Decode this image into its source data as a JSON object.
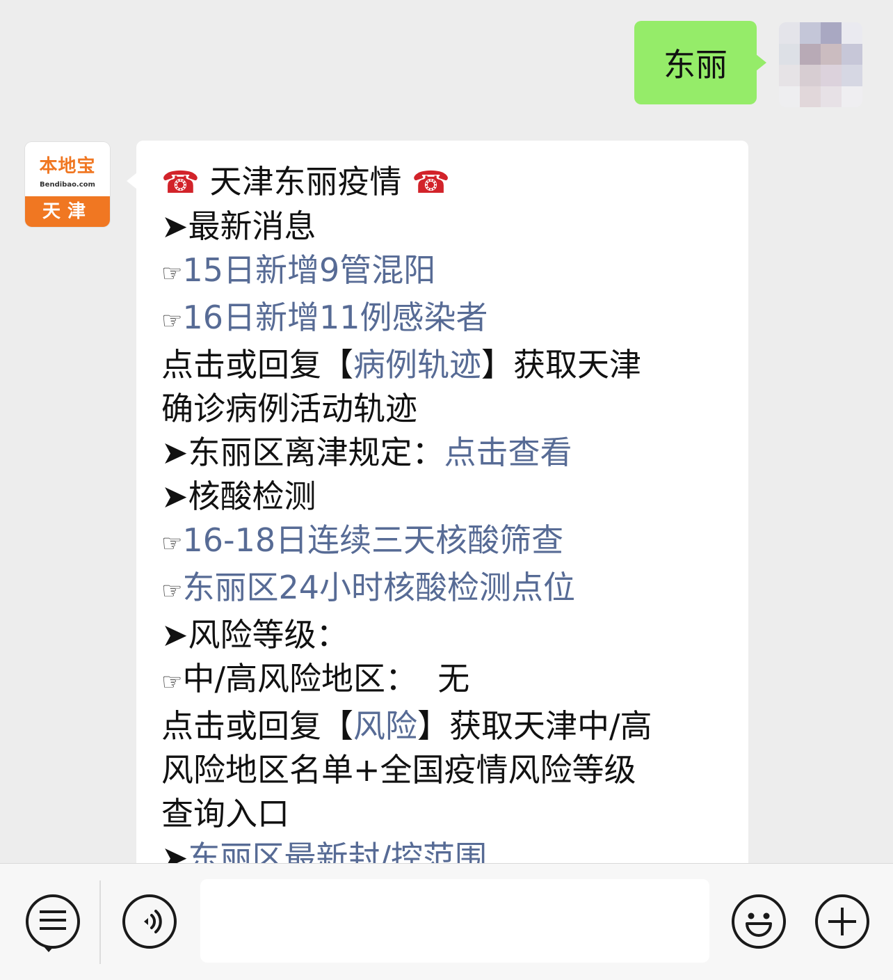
{
  "chat": {
    "outgoing": {
      "text": "东丽"
    },
    "incoming": {
      "title": "天津东丽疫情",
      "section_latest": "最新消息",
      "news1": "15日新增9管混阳",
      "news2": "16日新增11例感染者",
      "track_prefix": "点击或回复【",
      "track_link": "病例轨迹",
      "track_suffix": "】获取天津",
      "track_line2": "确诊病例活动轨迹",
      "leave_label": "东丽区离津规定：",
      "leave_link": "点击查看",
      "section_test": "核酸检测",
      "test1": "16-18日连续三天核酸筛查",
      "test2": "东丽区24小时核酸检测点位",
      "section_risk": "风险等级：",
      "risk_area": "中/高风险地区：  无",
      "risk_prefix": "点击或回复【",
      "risk_link": "风险",
      "risk_suffix": "】获取天津中/高",
      "risk_line2": "风险地区名单+全国疫情风险等级",
      "risk_line3": "查询入口",
      "lockdown_link": "东丽区最新封/控范围"
    },
    "bot_avatar": {
      "brand": "本地宝",
      "site": "Bendibao.com",
      "city": "天津"
    }
  },
  "icons": {
    "phone": "☎",
    "arrow": "➤",
    "hand": "☞"
  },
  "toolbar": {
    "menu_icon": "menu-icon",
    "voice_icon": "voice-icon",
    "emoji_icon": "emoji-icon",
    "plus_icon": "plus-icon",
    "input_value": ""
  },
  "colors": {
    "background": "#ededed",
    "outgoing_bubble": "#95ec69",
    "link": "#576b95",
    "brand_orange": "#f07722"
  }
}
